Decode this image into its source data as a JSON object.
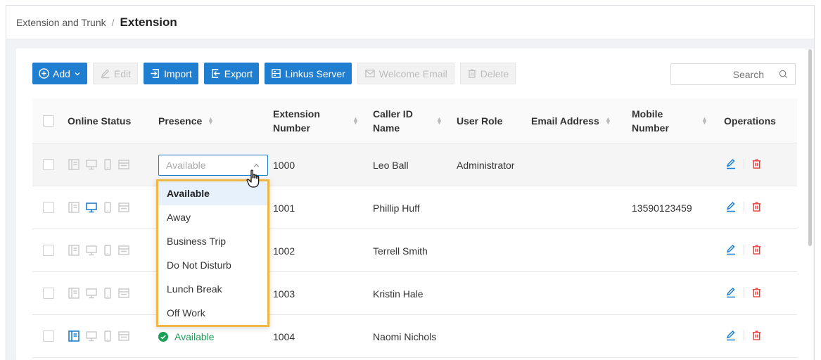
{
  "breadcrumb": {
    "parent": "Extension and Trunk",
    "separator": "/",
    "current": "Extension"
  },
  "toolbar": {
    "add": "Add",
    "edit": "Edit",
    "import": "Import",
    "export": "Export",
    "linkus": "Linkus Server",
    "welcome": "Welcome Email",
    "delete": "Delete"
  },
  "search": {
    "placeholder": "Search"
  },
  "columns": {
    "online_status": "Online Status",
    "presence": "Presence",
    "extension_number": "Extension Number",
    "caller_id_name": "Caller ID Name",
    "user_role": "User Role",
    "email_address": "Email Address",
    "mobile_number": "Mobile Number",
    "operations": "Operations"
  },
  "rows": [
    {
      "presence": "Available",
      "extension": "1000",
      "name": "Leo Ball",
      "role": "Administrator",
      "email": "",
      "mobile": ""
    },
    {
      "presence": "",
      "extension": "1001",
      "name": "Phillip Huff",
      "role": "",
      "email": "",
      "mobile": "13590123459"
    },
    {
      "presence": "",
      "extension": "1002",
      "name": "Terrell Smith",
      "role": "",
      "email": "",
      "mobile": ""
    },
    {
      "presence": "",
      "extension": "1003",
      "name": "Kristin Hale",
      "role": "",
      "email": "",
      "mobile": ""
    },
    {
      "presence": "Available",
      "extension": "1004",
      "name": "Naomi Nichols",
      "role": "",
      "email": "",
      "mobile": ""
    }
  ],
  "presence_options": [
    "Available",
    "Away",
    "Business Trip",
    "Do Not Disturb",
    "Lunch Break",
    "Off Work"
  ],
  "colors": {
    "primary": "#1f7ecf",
    "danger": "#e53935",
    "success": "#18a058",
    "highlight": "#f0b744"
  }
}
